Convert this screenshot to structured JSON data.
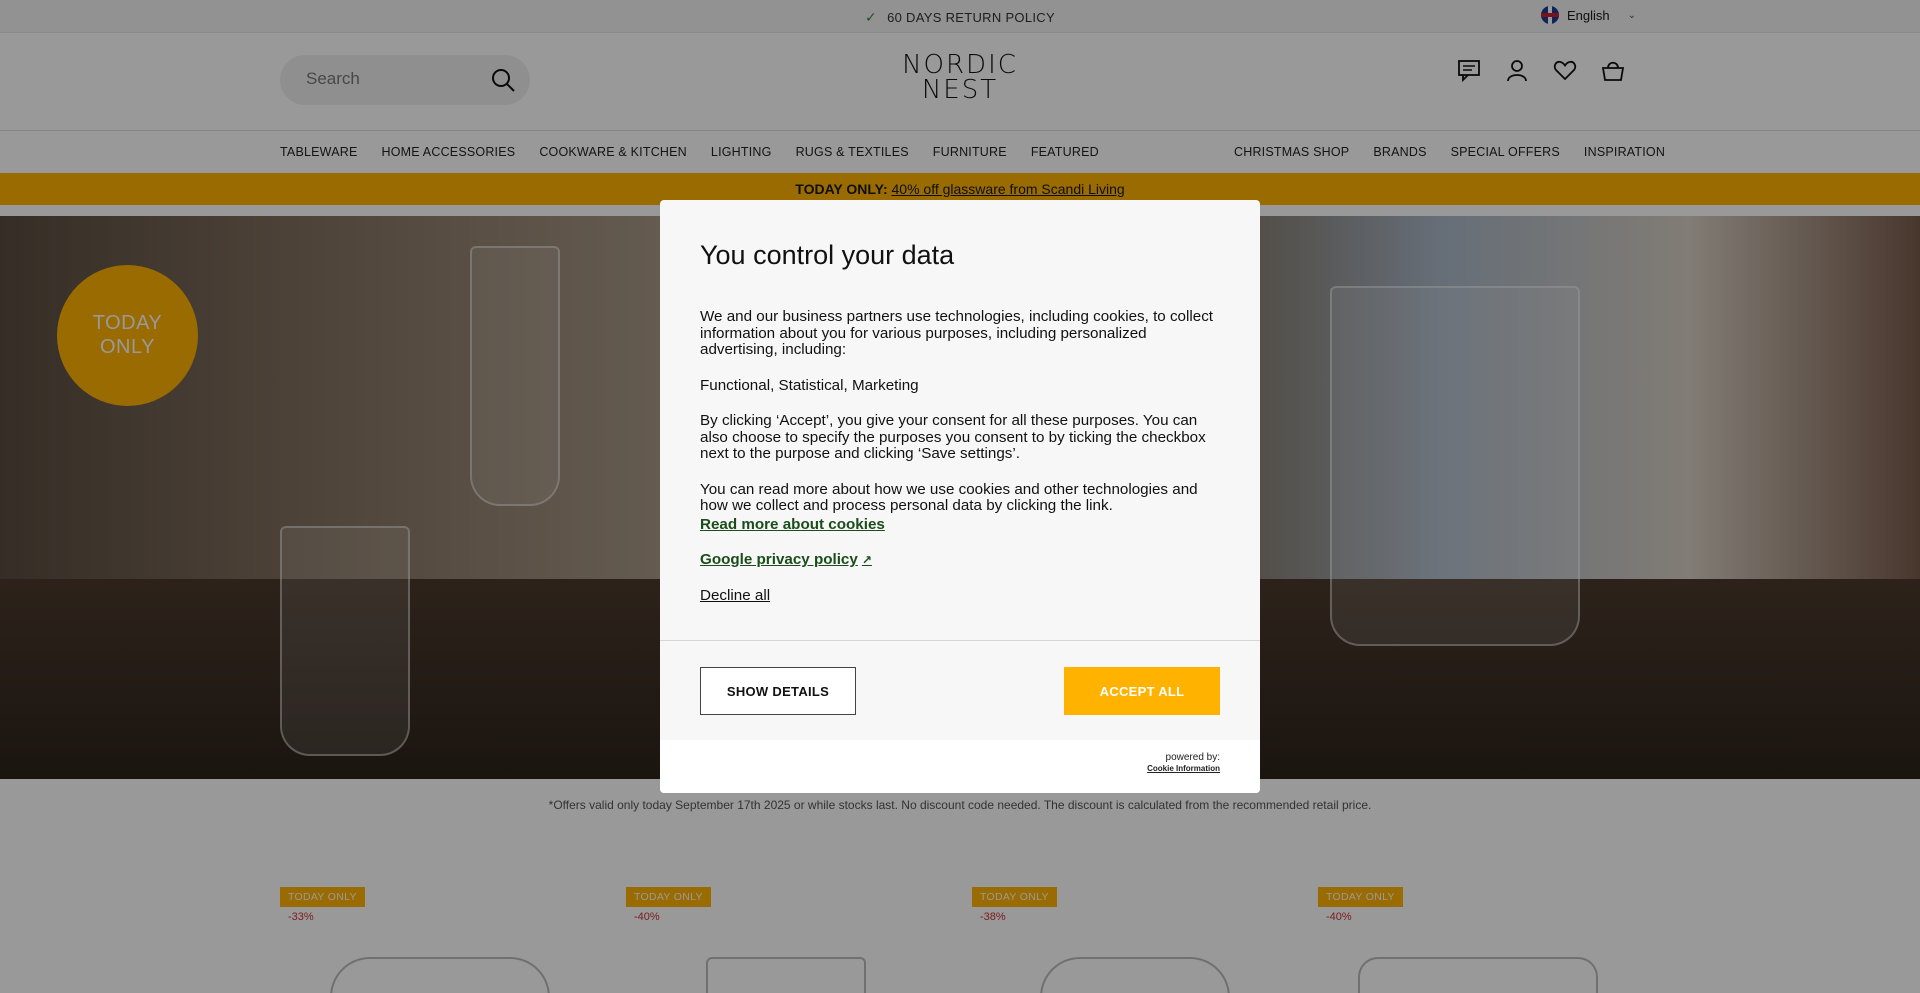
{
  "topbar": {
    "policy": "60 DAYS RETURN POLICY",
    "language": "English"
  },
  "header": {
    "search_placeholder": "Search",
    "logo_line1": "NORDIC",
    "logo_line2": "NEST",
    "icons": [
      "chat-icon",
      "user-icon",
      "heart-icon",
      "basket-icon"
    ]
  },
  "nav": {
    "left": [
      "TABLEWARE",
      "HOME ACCESSORIES",
      "COOKWARE & KITCHEN",
      "LIGHTING",
      "RUGS & TEXTILES",
      "FURNITURE",
      "FEATURED"
    ],
    "right": [
      "CHRISTMAS SHOP",
      "BRANDS",
      "SPECIAL OFFERS",
      "INSPIRATION"
    ]
  },
  "promo": {
    "bold": "TODAY ONLY:",
    "link": "40% off glassware from Scandi Living"
  },
  "hero": {
    "badge_line1": "TODAY",
    "badge_line2": "ONLY"
  },
  "offer_note": "*Offers valid only today September 17th 2025 or while stocks last. No discount code needed. The discount is calculated from the recommended retail price.",
  "products": [
    {
      "tag": "TODAY ONLY",
      "discount": "-33%"
    },
    {
      "tag": "TODAY ONLY",
      "discount": "-40%"
    },
    {
      "tag": "TODAY ONLY",
      "discount": "-38%"
    },
    {
      "tag": "TODAY ONLY",
      "discount": "-40%"
    }
  ],
  "modal": {
    "title": "You control your data",
    "p1": "We and our business partners use technologies, including cookies, to collect information about you for various purposes, including personalized advertising, including:",
    "p2": "Functional, Statistical, Marketing",
    "p3": "By clicking ‘Accept’, you give your consent for all these purposes. You can also choose to specify the purposes you consent to by ticking the checkbox next to the purpose and clicking ‘Save settings’.",
    "p4": "You can read more about how we use cookies and other technologies and how we collect and process personal data by clicking the link.",
    "read_more": "Read more about cookies",
    "google_policy": "Google privacy policy",
    "decline": "Decline all",
    "show_details": "SHOW DETAILS",
    "accept_all": "ACCEPT ALL",
    "powered_by": "powered by:",
    "powered_name": "Cookie Information"
  },
  "colors": {
    "accent": "#ffb200",
    "link_green": "#1a4d1a"
  }
}
